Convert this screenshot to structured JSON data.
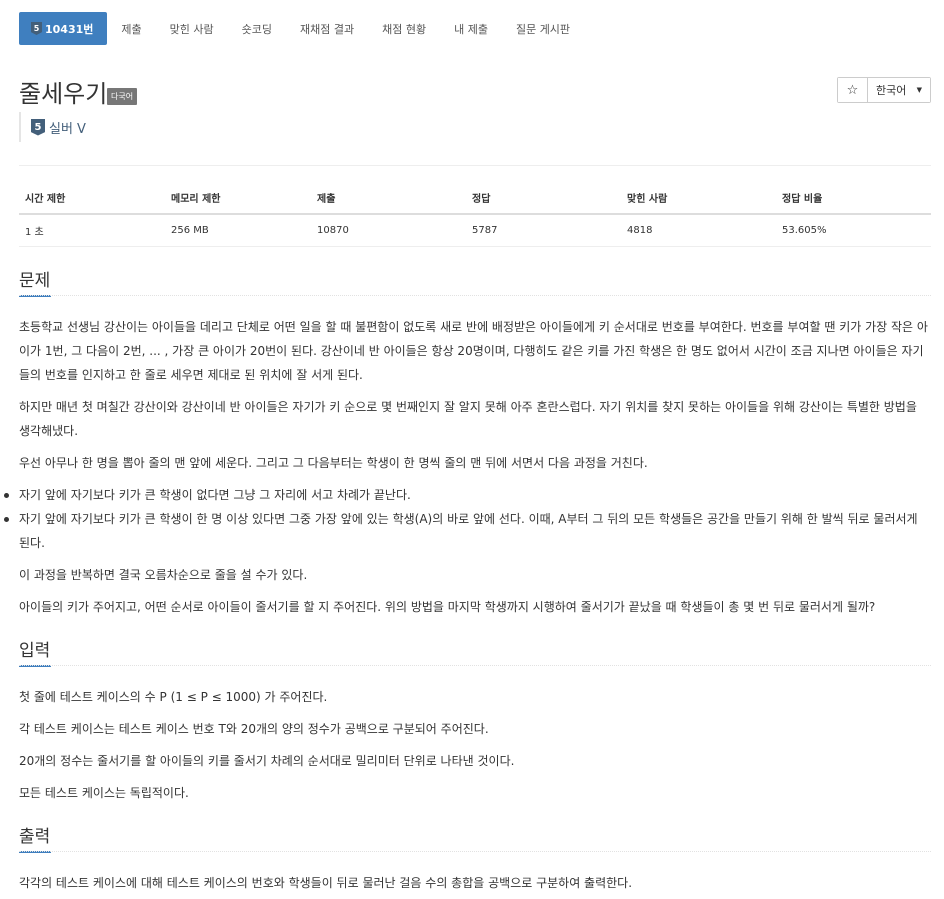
{
  "nav": {
    "tabs": [
      {
        "label": "10431번",
        "tier": "5",
        "active": true
      },
      {
        "label": "제출"
      },
      {
        "label": "맞힌 사람"
      },
      {
        "label": "숏코딩"
      },
      {
        "label": "재채점 결과"
      },
      {
        "label": "채점 현황"
      },
      {
        "label": "내 제출"
      },
      {
        "label": "질문 게시판"
      }
    ]
  },
  "problem": {
    "title": "줄세우기",
    "lang_label": "다국어",
    "tier_number": "5",
    "tier_name": "실버 V"
  },
  "toolbar": {
    "star": "☆",
    "language": "한국어"
  },
  "info_table": {
    "headers": [
      "시간 제한",
      "메모리 제한",
      "제출",
      "정답",
      "맞힌 사람",
      "정답 비율"
    ],
    "row": [
      "1 초",
      "256 MB",
      "10870",
      "5787",
      "4818",
      "53.605%"
    ]
  },
  "sections": {
    "problem_heading": "문제",
    "problem_paragraphs": [
      "초등학교 선생님 강산이는 아이들을 데리고 단체로 어떤 일을 할 때 불편함이 없도록 새로 반에 배정받은 아이들에게 키 순서대로 번호를 부여한다. 번호를 부여할 땐 키가 가장 작은 아이가 1번, 그 다음이 2번, ... , 가장 큰 아이가 20번이 된다. 강산이네 반 아이들은 항상 20명이며, 다행히도 같은 키를 가진 학생은 한 명도 없어서 시간이 조금 지나면 아이들은 자기들의 번호를 인지하고 한 줄로 세우면 제대로 된 위치에 잘 서게 된다.",
      "하지만 매년 첫 며칠간 강산이와 강산이네 반 아이들은 자기가 키 순으로 몇 번째인지 잘 알지 못해 아주 혼란스럽다. 자기 위치를 찾지 못하는 아이들을 위해 강산이는 특별한 방법을 생각해냈다.",
      "우선 아무나 한 명을 뽑아 줄의 맨 앞에 세운다. 그리고 그 다음부터는 학생이 한 명씩 줄의 맨 뒤에 서면서 다음 과정을 거친다."
    ],
    "bullets": [
      "자기 앞에 자기보다 키가 큰 학생이 없다면 그냥 그 자리에 서고 차례가 끝난다.",
      "자기 앞에 자기보다 키가 큰 학생이 한 명 이상 있다면 그중 가장 앞에 있는 학생(A)의 바로 앞에 선다. 이때, A부터 그 뒤의 모든 학생들은 공간을 만들기 위해 한 발씩 뒤로 물러서게 된다."
    ],
    "after_bullets": [
      "이 과정을 반복하면 결국 오름차순으로 줄을 설 수가 있다.",
      "아이들의 키가 주어지고, 어떤 순서로 아이들이 줄서기를 할 지 주어진다. 위의 방법을 마지막 학생까지 시행하여 줄서기가 끝났을 때 학생들이 총 몇 번 뒤로 물러서게 될까?"
    ],
    "input_heading": "입력",
    "input_paragraphs": [
      "첫 줄에 테스트 케이스의 수 P (1 ≤ P ≤ 1000) 가 주어진다.",
      "각 테스트 케이스는 테스트 케이스 번호 T와 20개의 양의 정수가 공백으로 구분되어 주어진다.",
      "20개의 정수는 줄서기를 할 아이들의 키를 줄서기 차례의 순서대로 밀리미터 단위로 나타낸 것이다.",
      "모든 테스트 케이스는 독립적이다."
    ],
    "output_heading": "출력",
    "output_paragraphs": [
      "각각의 테스트 케이스에 대해 테스트 케이스의 번호와 학생들이 뒤로 물러난 걸음 수의 총합을 공백으로 구분하여 출력한다."
    ]
  },
  "colors": {
    "accent": "#3f7fbf",
    "tier_silver": "#435f7a",
    "label_gray": "#777777"
  }
}
